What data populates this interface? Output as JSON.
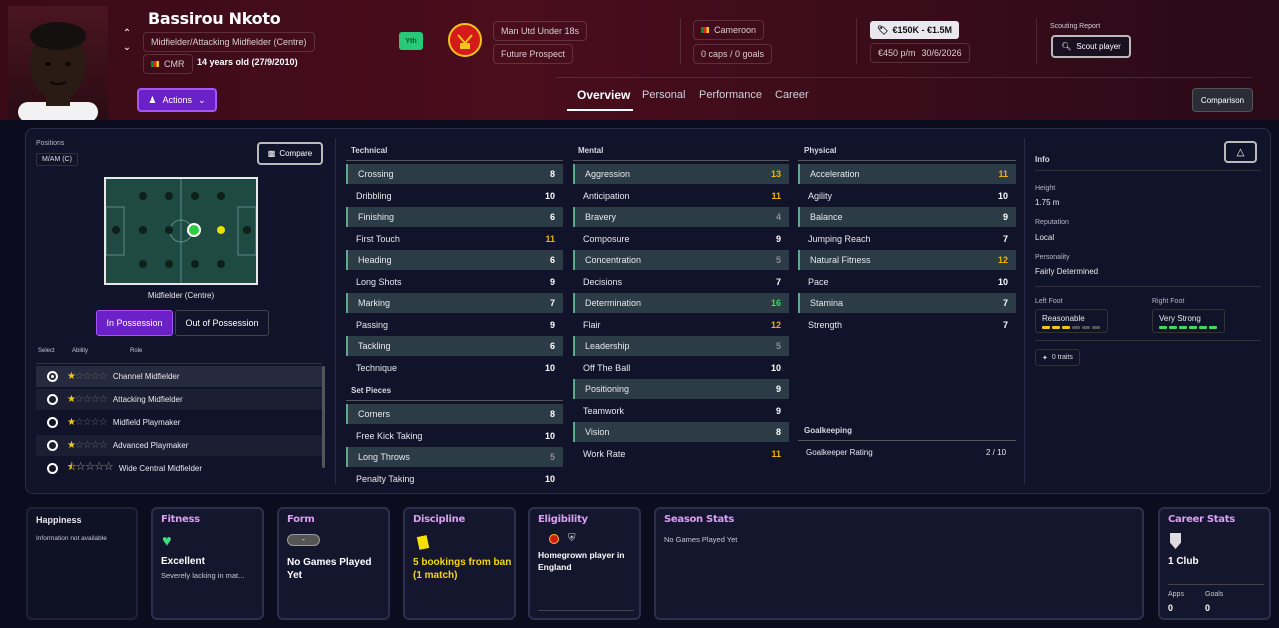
{
  "player": {
    "name": "Bassirou Nkoto",
    "position": "Midfielder/Attacking Midfielder (Centre)",
    "nation_code": "CMR",
    "age": "14 years old (27/9/2010)",
    "badge": "Yth",
    "actions_label": "Actions"
  },
  "club": {
    "team": "Man Utd Under 18s",
    "status": "Future Prospect"
  },
  "nation": {
    "name": "Cameroon",
    "caps": "0 caps / 0 goals"
  },
  "contract": {
    "value": "€150K - €1.5M",
    "wage": "€450 p/m",
    "expiry": "30/6/2026"
  },
  "scouting": {
    "title": "Scouting Report",
    "button": "Scout player"
  },
  "tabs": [
    "Overview",
    "Personal",
    "Performance",
    "Career"
  ],
  "comparison_label": "Comparison",
  "positions": {
    "title": "Positions",
    "tag": "M/AM (C)",
    "compare_label": "Compare",
    "pitch_caption": "Midfielder (Centre)",
    "in_possession": "In Possession",
    "out_possession": "Out of Possession",
    "col_select": "Select",
    "col_ability": "Ability",
    "col_role": "Role",
    "roles": [
      {
        "name": "Channel Midfielder",
        "stars": 1,
        "selected": true
      },
      {
        "name": "Attacking Midfielder",
        "stars": 1,
        "selected": false
      },
      {
        "name": "Midfield Playmaker",
        "stars": 1,
        "selected": false
      },
      {
        "name": "Advanced Playmaker",
        "stars": 1,
        "selected": false
      },
      {
        "name": "Wide Central Midfielder",
        "stars": 0.5,
        "selected": false
      }
    ]
  },
  "technical": {
    "title": "Technical",
    "items": [
      {
        "name": "Crossing",
        "value": "8"
      },
      {
        "name": "Dribbling",
        "value": "10"
      },
      {
        "name": "Finishing",
        "value": "6"
      },
      {
        "name": "First Touch",
        "value": "11"
      },
      {
        "name": "Heading",
        "value": "6"
      },
      {
        "name": "Long Shots",
        "value": "9"
      },
      {
        "name": "Marking",
        "value": "7"
      },
      {
        "name": "Passing",
        "value": "9"
      },
      {
        "name": "Tackling",
        "value": "6"
      },
      {
        "name": "Technique",
        "value": "10"
      }
    ]
  },
  "set_pieces": {
    "title": "Set Pieces",
    "items": [
      {
        "name": "Corners",
        "value": "8"
      },
      {
        "name": "Free Kick Taking",
        "value": "10"
      },
      {
        "name": "Long Throws",
        "value": "5"
      },
      {
        "name": "Penalty Taking",
        "value": "10"
      }
    ]
  },
  "mental": {
    "title": "Mental",
    "items": [
      {
        "name": "Aggression",
        "value": "13"
      },
      {
        "name": "Anticipation",
        "value": "11"
      },
      {
        "name": "Bravery",
        "value": "4"
      },
      {
        "name": "Composure",
        "value": "9"
      },
      {
        "name": "Concentration",
        "value": "5"
      },
      {
        "name": "Decisions",
        "value": "7"
      },
      {
        "name": "Determination",
        "value": "16"
      },
      {
        "name": "Flair",
        "value": "12"
      },
      {
        "name": "Leadership",
        "value": "5"
      },
      {
        "name": "Off The Ball",
        "value": "10"
      },
      {
        "name": "Positioning",
        "value": "9"
      },
      {
        "name": "Teamwork",
        "value": "9"
      },
      {
        "name": "Vision",
        "value": "8"
      },
      {
        "name": "Work Rate",
        "value": "11"
      }
    ]
  },
  "physical": {
    "title": "Physical",
    "items": [
      {
        "name": "Acceleration",
        "value": "11"
      },
      {
        "name": "Agility",
        "value": "10"
      },
      {
        "name": "Balance",
        "value": "9"
      },
      {
        "name": "Jumping Reach",
        "value": "7"
      },
      {
        "name": "Natural Fitness",
        "value": "12"
      },
      {
        "name": "Pace",
        "value": "10"
      },
      {
        "name": "Stamina",
        "value": "7"
      },
      {
        "name": "Strength",
        "value": "7"
      }
    ]
  },
  "goalkeeping": {
    "title": "Goalkeeping",
    "label": "Goalkeeper Rating",
    "value": "2 / 10"
  },
  "info": {
    "title": "Info",
    "height_label": "Height",
    "height": "1.75 m",
    "reputation_label": "Reputation",
    "reputation": "Local",
    "personality_label": "Personality",
    "personality": "Fairly Determined",
    "left_foot_label": "Left Foot",
    "left_foot": "Reasonable",
    "left_foot_level": 0.5,
    "right_foot_label": "Right Foot",
    "right_foot": "Very Strong",
    "right_foot_level": 1.0,
    "traits": "0 traits"
  },
  "cards": {
    "happiness_title": "Happiness",
    "happiness_text": "Information not available",
    "fitness_title": "Fitness",
    "fitness_value": "Excellent",
    "fitness_sub": "Severely lacking in mat...",
    "form_title": "Form",
    "form_badge": "-",
    "form_value": "No Games Played Yet",
    "discipline_title": "Discipline",
    "discipline_value": "5 bookings from ban (1 match)",
    "eligibility_title": "Eligibility",
    "eligibility_value": "Homegrown player in England",
    "season_title": "Season Stats",
    "season_text": "No Games Played Yet",
    "career_title": "Career Stats",
    "career_club": "1 Club",
    "apps_label": "Apps",
    "apps": "0",
    "goals_label": "Goals",
    "goals": "0"
  },
  "colors": {
    "accent_purple": "#6b21c8",
    "highlight_green": "#5fa88a",
    "value_orange": "#f5b400",
    "value_green": "#40d860"
  }
}
